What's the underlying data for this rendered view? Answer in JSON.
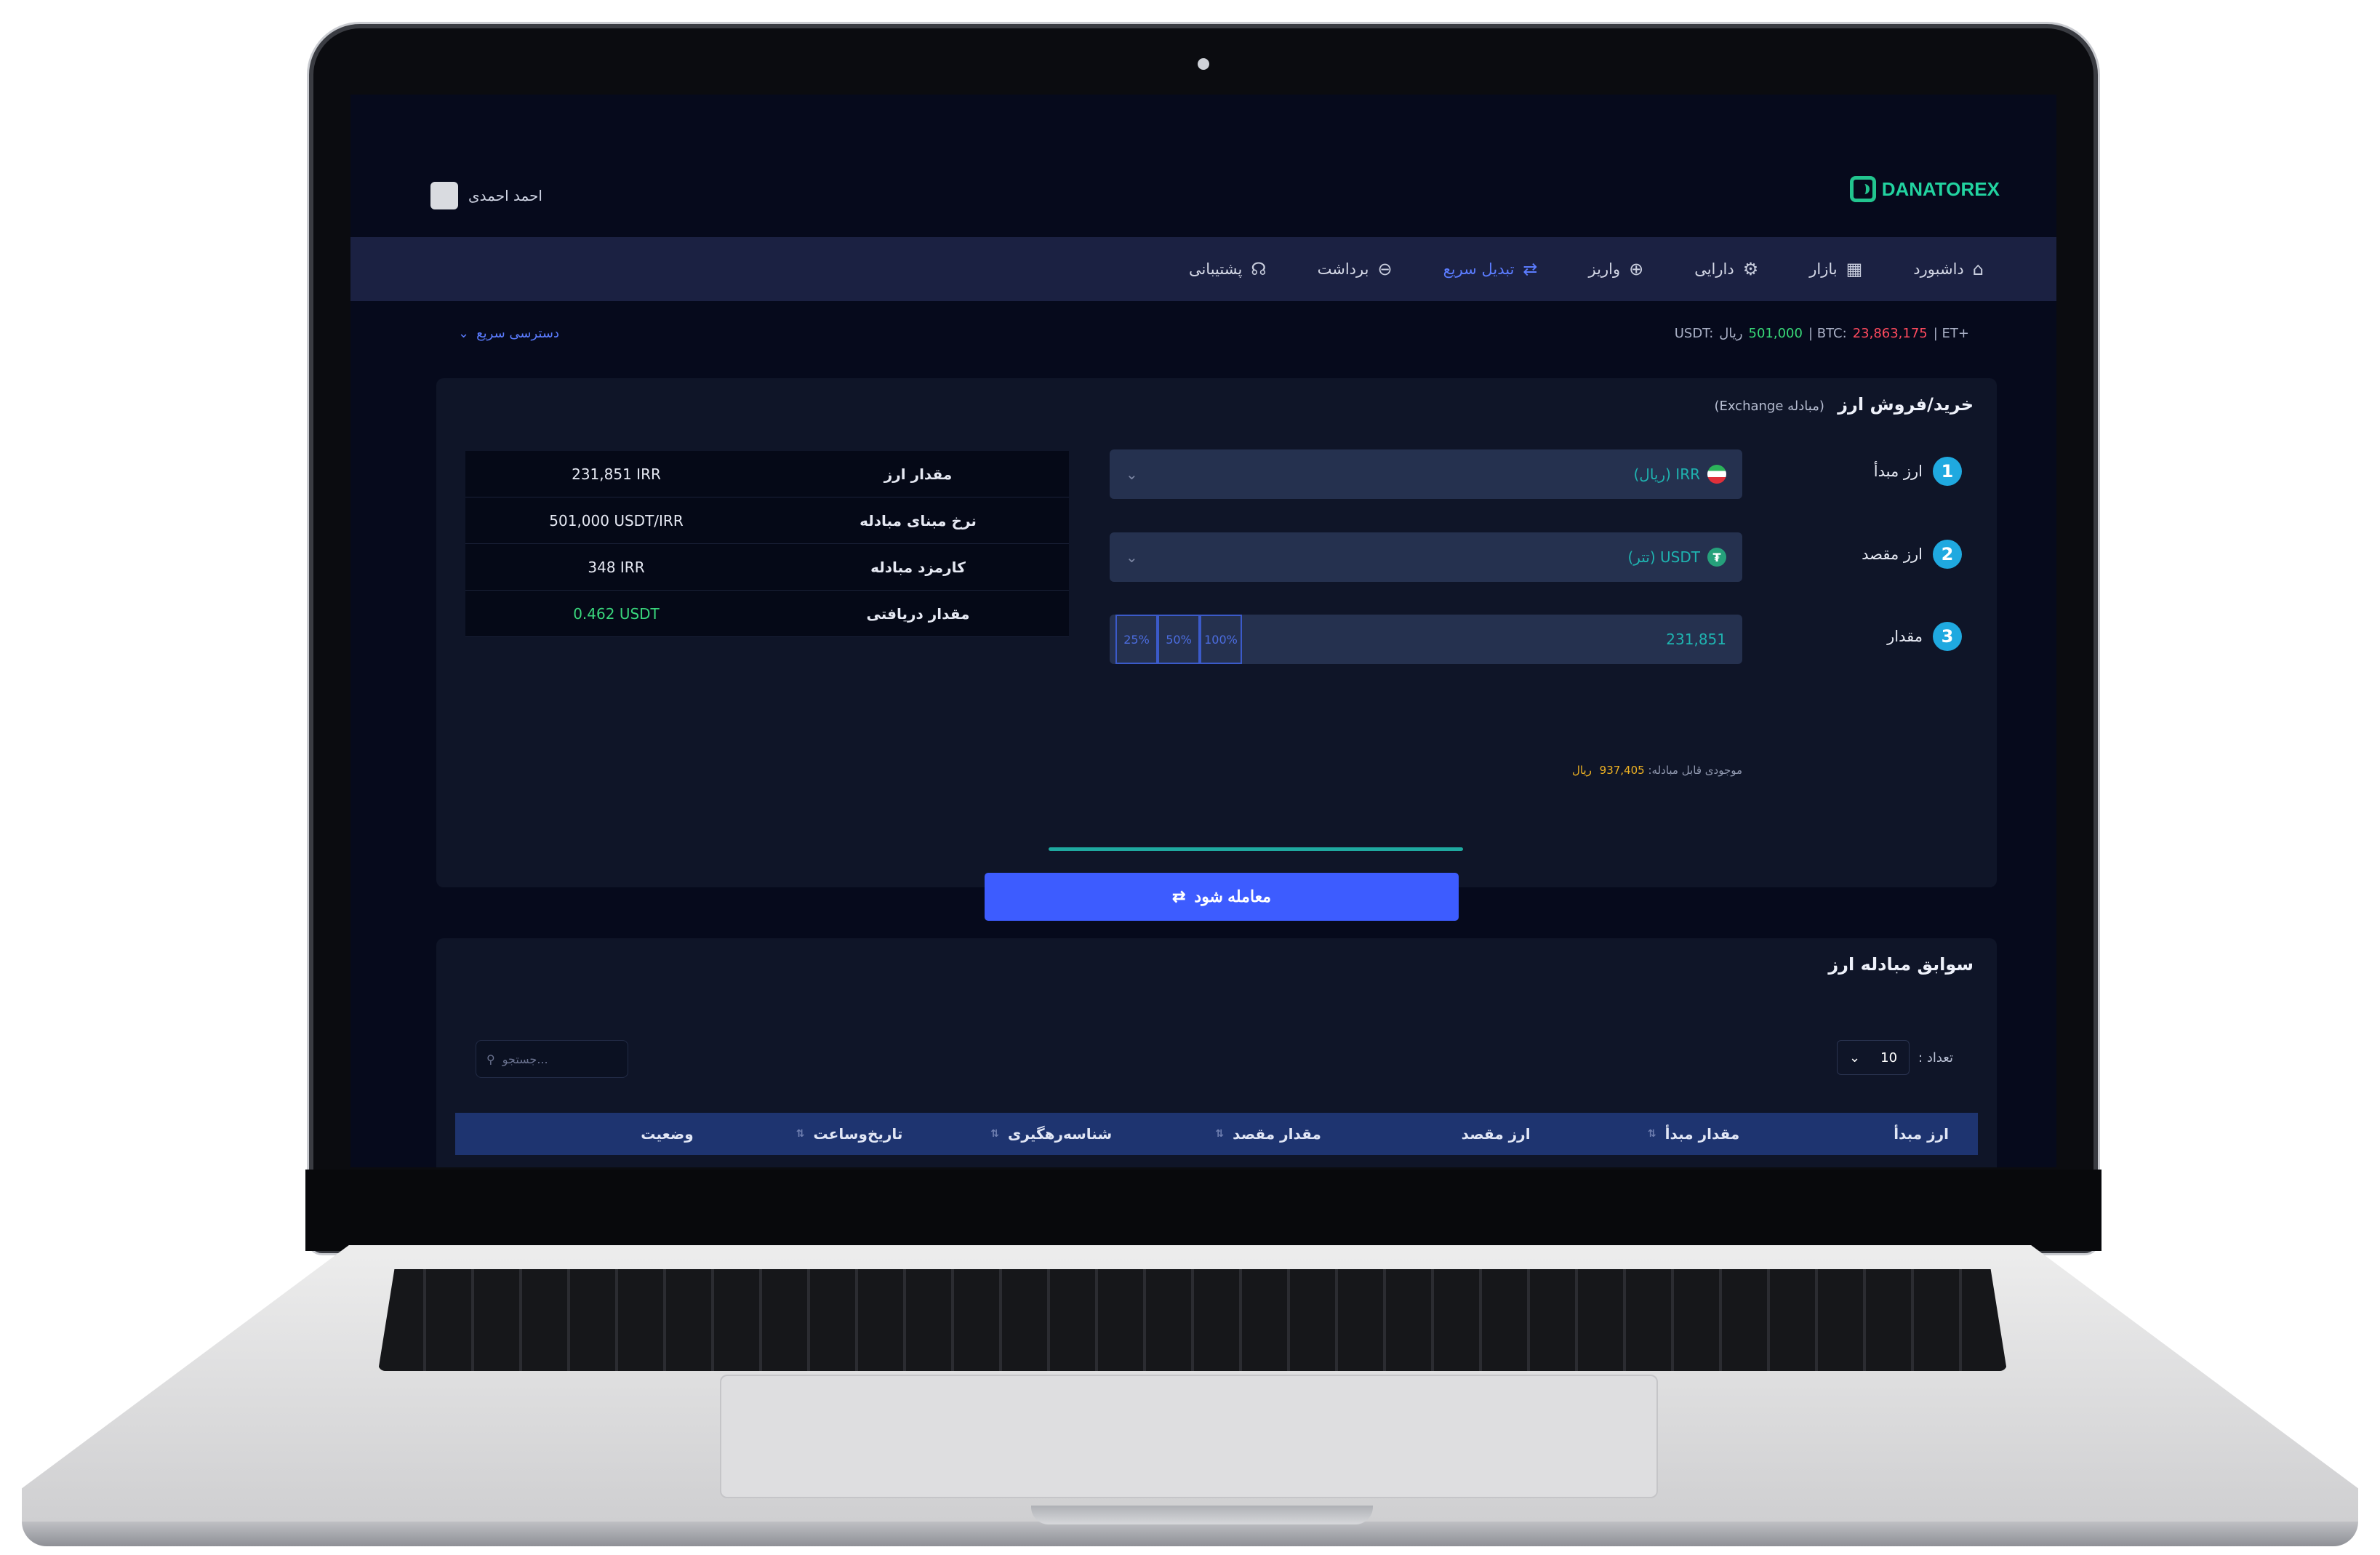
{
  "app": {
    "brand": "DANATOREX",
    "user_name": "احمد احمدی"
  },
  "nav": [
    {
      "label": "داشبورد",
      "icon": "home-icon",
      "glyph": "⌂"
    },
    {
      "label": "بازار",
      "icon": "market-icon",
      "glyph": "▦"
    },
    {
      "label": "دارایی",
      "icon": "wallet-icon",
      "glyph": "⚙"
    },
    {
      "label": "واریز",
      "icon": "deposit-icon",
      "glyph": "⊕"
    },
    {
      "label": "تبدیل سریع",
      "icon": "swap-icon",
      "glyph": "⇄"
    },
    {
      "label": "برداشت",
      "icon": "withdraw-icon",
      "glyph": "⊖"
    },
    {
      "label": "پشتیبانی",
      "icon": "headset-icon",
      "glyph": "☊"
    }
  ],
  "ticker": {
    "usdt_label": "USDT:",
    "usdt_value": "501,000",
    "usdt_unit": "ریال",
    "btc_label": "| BTC:",
    "btc_value": "23,863,175",
    "eth_label": "| ET+"
  },
  "quick_access": "دسترسی سریع",
  "exchange": {
    "title": "خرید/فروش ارز",
    "subtitle": "(مبادله Exchange)",
    "steps": [
      {
        "num": "1",
        "label": "ارز مبدأ"
      },
      {
        "num": "2",
        "label": "ارز مقصد"
      },
      {
        "num": "3",
        "label": "مقدار"
      }
    ],
    "source_currency": "IRR (ریال)",
    "target_currency": "USDT (تتر)",
    "amount_value": "231,851",
    "percent_buttons": [
      "25%",
      "50%",
      "100%"
    ],
    "balance_label": "موجودی قابل مبادله:",
    "balance_value": "937,405",
    "balance_unit": "ریال",
    "trade_button": "معامله شود"
  },
  "summary": [
    {
      "label": "مقدار ارز",
      "value": "231,851 IRR",
      "accent": false
    },
    {
      "label": "نرخ مبنای مبادله",
      "value": "501,000 USDT/IRR",
      "accent": false
    },
    {
      "label": "کارمزد مبادله",
      "value": "348 IRR",
      "accent": false
    },
    {
      "label": "مقدار دریافتی",
      "value": "0.462 USDT",
      "accent": true
    }
  ],
  "history": {
    "title": "سوابق مبادله ارز",
    "count_label": "تعداد :",
    "count_value": "10",
    "search_placeholder": "جستجو...",
    "columns": [
      "ارز مبدأ",
      "مقدار مبدأ",
      "ارز مقصد",
      "مقدار مقصد",
      "شناسه‌رهگیری",
      "تاریخ‌وساعت",
      "وضعیت"
    ]
  },
  "colors": {
    "accent": "#3d5cff",
    "brand": "#22d3a0",
    "positive": "#39d67c",
    "negative": "#ff4a5e"
  }
}
